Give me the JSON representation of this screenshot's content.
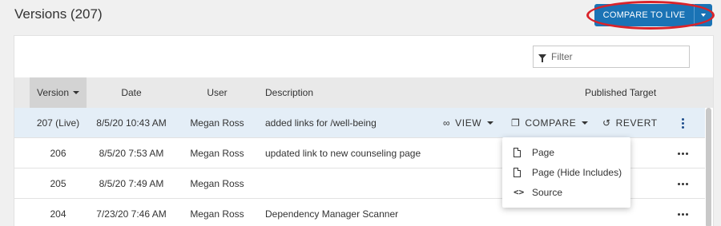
{
  "page": {
    "title": "Versions (207)",
    "compare_to_live_label": "COMPARE TO LIVE",
    "accent_color": "#1a73b5",
    "highlight_color": "#d9232a"
  },
  "filter": {
    "placeholder": "Filter"
  },
  "table": {
    "columns": [
      "Version",
      "Date",
      "User",
      "Description",
      "Published Target"
    ],
    "sorted_column": "Version",
    "rows": [
      {
        "version": "207 (Live)",
        "date": "8/5/20 10:43 AM",
        "user": "Megan Ross",
        "description": "added links for /well-being",
        "live": true
      },
      {
        "version": "206",
        "date": "8/5/20 7:53 AM",
        "user": "Megan Ross",
        "description": "updated link to new counseling page"
      },
      {
        "version": "205",
        "date": "8/5/20 7:49 AM",
        "user": "Megan Ross",
        "description": ""
      },
      {
        "version": "204",
        "date": "7/23/20 7:46 AM",
        "user": "Megan Ross",
        "description": "Dependency Manager Scanner"
      }
    ],
    "live_actions": {
      "view": "VIEW",
      "compare": "COMPARE",
      "revert": "REVERT"
    }
  },
  "compare_menu": {
    "items": [
      {
        "label": "Page",
        "icon": "document-icon"
      },
      {
        "label": "Page (Hide Includes)",
        "icon": "document-icon"
      },
      {
        "label": "Source",
        "icon": "code-icon"
      }
    ]
  }
}
